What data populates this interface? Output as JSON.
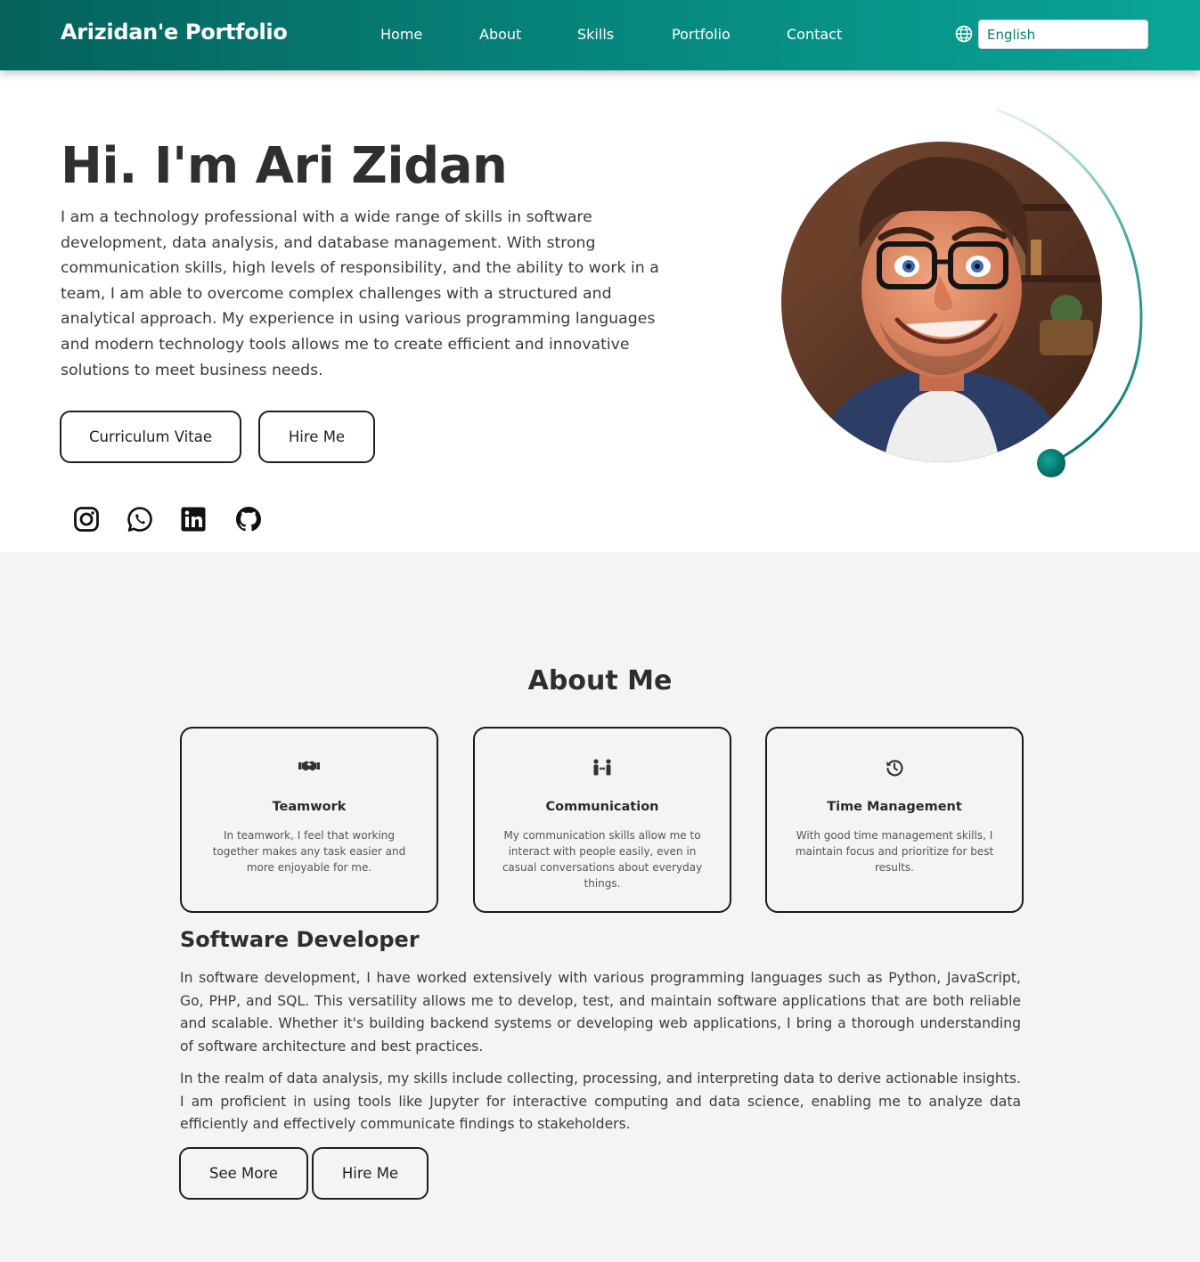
{
  "nav": {
    "brand": "Arizidan'e Portfolio",
    "links": [
      "Home",
      "About",
      "Skills",
      "Portfolio",
      "Contact"
    ],
    "language": "English"
  },
  "hero": {
    "title": "Hi. I'm Ari Zidan",
    "text": "I am a technology professional with a wide range of skills in software development, data analysis, and database management. With strong communication skills, high levels of responsibility, and the ability to work in a team, I am able to overcome complex challenges with a structured and analytical approach. My experience in using various programming languages and modern technology tools allows me to create efficient and innovative solutions to meet business needs.",
    "cv_button": "Curriculum Vitae",
    "hire_button": "Hire Me",
    "socials": [
      "instagram-icon",
      "whatsapp-icon",
      "linkedin-icon",
      "github-icon"
    ]
  },
  "about": {
    "title": "About Me",
    "cards": [
      {
        "icon": "handshake-icon",
        "title": "Teamwork",
        "text": "In teamwork, I feel that working together makes any task easier and more enjoyable for me."
      },
      {
        "icon": "people-arrows-icon",
        "title": "Communication",
        "text": "My communication skills allow me to interact with people easily, even in casual conversations about everyday things."
      },
      {
        "icon": "history-icon",
        "title": "Time Management",
        "text": "With good time management skills, I maintain focus and prioritize for best results."
      }
    ],
    "subtitle": "Software Developer",
    "para1": "In software development, I have worked extensively with various programming languages such as Python, JavaScript, Go, PHP, and SQL. This versatility allows me to develop, test, and maintain software applications that are both reliable and scalable. Whether it's building backend systems or developing web applications, I bring a thorough understanding of software architecture and best practices.",
    "para2": "In the realm of data analysis, my skills include collecting, processing, and interpreting data to derive actionable insights. I am proficient in using tools like Jupyter for interactive computing and data science, enabling me to analyze data efficiently and effectively communicate findings to stakeholders.",
    "see_more_button": "See More",
    "hire_button": "Hire Me"
  },
  "colors": {
    "nav_start": "#05615c",
    "nav_end": "#0aa596",
    "accent": "#0a7c74"
  }
}
